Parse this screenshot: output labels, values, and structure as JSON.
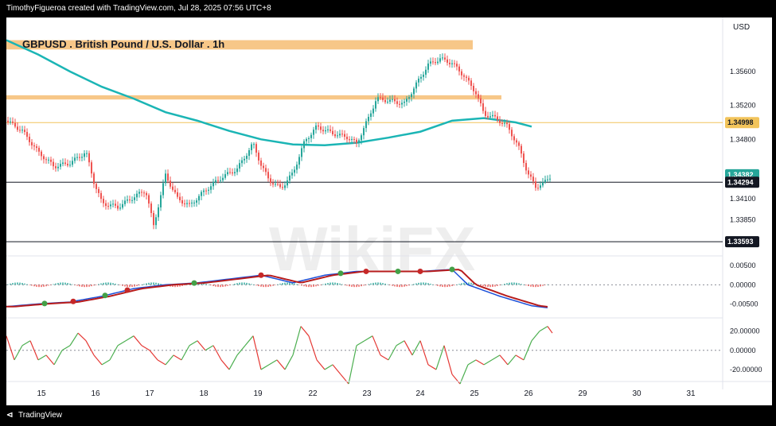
{
  "header": {
    "attribution": "TimothyFigueroa created with TradingView.com, Jul 28, 2025 07:56 UTC+8"
  },
  "footer": {
    "brand": "TradingView",
    "logo_icon": "tradingview-logo-icon"
  },
  "watermark": "WikiFX",
  "chart_data": {
    "type": "candlestick",
    "title": "GBPUSD . British Pound / U.S. Dollar . 1h",
    "currency": "USD",
    "x_ticks": [
      "15",
      "16",
      "17",
      "18",
      "19",
      "22",
      "23",
      "24",
      "25",
      "26",
      "29",
      "30",
      "31"
    ],
    "price_axis": {
      "ticks": [
        "1.35600",
        "1.35200",
        "1.34800",
        "1.34100",
        "1.33850"
      ],
      "labels": [
        {
          "value": 1.34998,
          "text": "1.34998",
          "bg": "#f2c45b",
          "color": "#131722"
        },
        {
          "value": 1.34382,
          "text": "1.34382",
          "bg": "#26a69a",
          "color": "#ffffff"
        },
        {
          "value": 1.34294,
          "text": "1.34294",
          "bg": "#131722",
          "color": "#ffffff"
        },
        {
          "value": 1.33593,
          "text": "1.33593",
          "bg": "#131722",
          "color": "#ffffff"
        }
      ]
    },
    "resistance_zones": [
      {
        "low": 1.3586,
        "high": 1.3597,
        "color": "#f7c788"
      },
      {
        "low": 1.3527,
        "high": 1.3532,
        "color": "#f7c788"
      }
    ],
    "horizontal_lines": [
      {
        "value": 1.34998,
        "color": "#f2c45b"
      },
      {
        "value": 1.34294,
        "color": "#131722"
      },
      {
        "value": 1.33593,
        "color": "#131722"
      }
    ],
    "ma_line": {
      "color": "#1bb5b5",
      "points": [
        [
          0,
          1.3597
        ],
        [
          40,
          1.358
        ],
        [
          80,
          1.356
        ],
        [
          120,
          1.3542
        ],
        [
          160,
          1.3528
        ],
        [
          200,
          1.3512
        ],
        [
          240,
          1.3502
        ],
        [
          280,
          1.349
        ],
        [
          320,
          1.348
        ],
        [
          360,
          1.3474
        ],
        [
          400,
          1.3473
        ],
        [
          440,
          1.3476
        ],
        [
          480,
          1.3482
        ],
        [
          520,
          1.3489
        ],
        [
          560,
          1.3502
        ],
        [
          600,
          1.3505
        ],
        [
          640,
          1.35
        ],
        [
          660,
          1.3495
        ]
      ]
    },
    "price_path": [
      [
        0,
        1.3502
      ],
      [
        20,
        1.349
      ],
      [
        40,
        1.3465
      ],
      [
        60,
        1.3448
      ],
      [
        80,
        1.3452
      ],
      [
        100,
        1.3465
      ],
      [
        110,
        1.343
      ],
      [
        120,
        1.3405
      ],
      [
        140,
        1.34
      ],
      [
        160,
        1.3412
      ],
      [
        175,
        1.342
      ],
      [
        185,
        1.3378
      ],
      [
        200,
        1.3438
      ],
      [
        215,
        1.341
      ],
      [
        230,
        1.3402
      ],
      [
        250,
        1.342
      ],
      [
        270,
        1.3435
      ],
      [
        290,
        1.3445
      ],
      [
        310,
        1.3475
      ],
      [
        320,
        1.345
      ],
      [
        330,
        1.3432
      ],
      [
        345,
        1.3422
      ],
      [
        360,
        1.344
      ],
      [
        375,
        1.3478
      ],
      [
        390,
        1.3495
      ],
      [
        410,
        1.3487
      ],
      [
        430,
        1.3482
      ],
      [
        440,
        1.3475
      ],
      [
        455,
        1.3505
      ],
      [
        465,
        1.3528
      ],
      [
        485,
        1.3525
      ],
      [
        500,
        1.3522
      ],
      [
        515,
        1.3545
      ],
      [
        530,
        1.3568
      ],
      [
        545,
        1.3575
      ],
      [
        560,
        1.357
      ],
      [
        575,
        1.3555
      ],
      [
        590,
        1.3535
      ],
      [
        600,
        1.351
      ],
      [
        615,
        1.3505
      ],
      [
        630,
        1.3495
      ],
      [
        645,
        1.3468
      ],
      [
        655,
        1.344
      ],
      [
        665,
        1.3424
      ],
      [
        675,
        1.3428
      ],
      [
        685,
        1.3438
      ]
    ],
    "macd": {
      "ticks": [
        "0.00500",
        "0.00000",
        "-0.00500"
      ],
      "macd_line_color": "#1b4fd8",
      "signal_line_color": "#b71c1c",
      "points": [
        [
          0,
          -0.0057
        ],
        [
          40,
          -0.005
        ],
        [
          80,
          -0.0045
        ],
        [
          120,
          -0.003
        ],
        [
          160,
          -0.001
        ],
        [
          200,
          0.0
        ],
        [
          240,
          0.0005
        ],
        [
          280,
          0.0015
        ],
        [
          320,
          0.0025
        ],
        [
          360,
          0.0005
        ],
        [
          400,
          0.0025
        ],
        [
          440,
          0.0035
        ],
        [
          480,
          0.0035
        ],
        [
          520,
          0.0035
        ],
        [
          560,
          0.004
        ],
        [
          580,
          0.0
        ],
        [
          620,
          -0.003
        ],
        [
          660,
          -0.0055
        ],
        [
          680,
          -0.006
        ]
      ]
    },
    "oscillator": {
      "ticks": [
        "20.00000",
        "0.00000",
        "-20.00000"
      ],
      "points": [
        [
          0,
          15
        ],
        [
          10,
          -10
        ],
        [
          20,
          5
        ],
        [
          30,
          10
        ],
        [
          40,
          -10
        ],
        [
          50,
          -5
        ],
        [
          60,
          -15
        ],
        [
          70,
          0
        ],
        [
          80,
          5
        ],
        [
          90,
          18
        ],
        [
          100,
          10
        ],
        [
          110,
          -5
        ],
        [
          120,
          -15
        ],
        [
          130,
          -10
        ],
        [
          140,
          5
        ],
        [
          150,
          10
        ],
        [
          160,
          15
        ],
        [
          170,
          5
        ],
        [
          180,
          0
        ],
        [
          190,
          -10
        ],
        [
          200,
          -15
        ],
        [
          210,
          -5
        ],
        [
          220,
          -10
        ],
        [
          230,
          5
        ],
        [
          240,
          10
        ],
        [
          250,
          0
        ],
        [
          260,
          5
        ],
        [
          270,
          -10
        ],
        [
          280,
          -20
        ],
        [
          290,
          -5
        ],
        [
          300,
          5
        ],
        [
          310,
          15
        ],
        [
          320,
          -20
        ],
        [
          330,
          -15
        ],
        [
          340,
          -10
        ],
        [
          350,
          -20
        ],
        [
          360,
          -5
        ],
        [
          370,
          25
        ],
        [
          380,
          15
        ],
        [
          390,
          -10
        ],
        [
          400,
          -20
        ],
        [
          410,
          -15
        ],
        [
          420,
          -25
        ],
        [
          430,
          -35
        ],
        [
          440,
          5
        ],
        [
          450,
          10
        ],
        [
          460,
          15
        ],
        [
          470,
          -5
        ],
        [
          480,
          -10
        ],
        [
          490,
          5
        ],
        [
          500,
          10
        ],
        [
          510,
          -5
        ],
        [
          520,
          10
        ],
        [
          530,
          -15
        ],
        [
          540,
          -20
        ],
        [
          550,
          5
        ],
        [
          560,
          -25
        ],
        [
          570,
          -35
        ],
        [
          580,
          -15
        ],
        [
          590,
          -10
        ],
        [
          600,
          -15
        ],
        [
          610,
          -10
        ],
        [
          620,
          -5
        ],
        [
          630,
          -15
        ],
        [
          640,
          -5
        ],
        [
          650,
          -10
        ],
        [
          660,
          10
        ],
        [
          670,
          20
        ],
        [
          680,
          25
        ],
        [
          686,
          18
        ]
      ]
    }
  }
}
